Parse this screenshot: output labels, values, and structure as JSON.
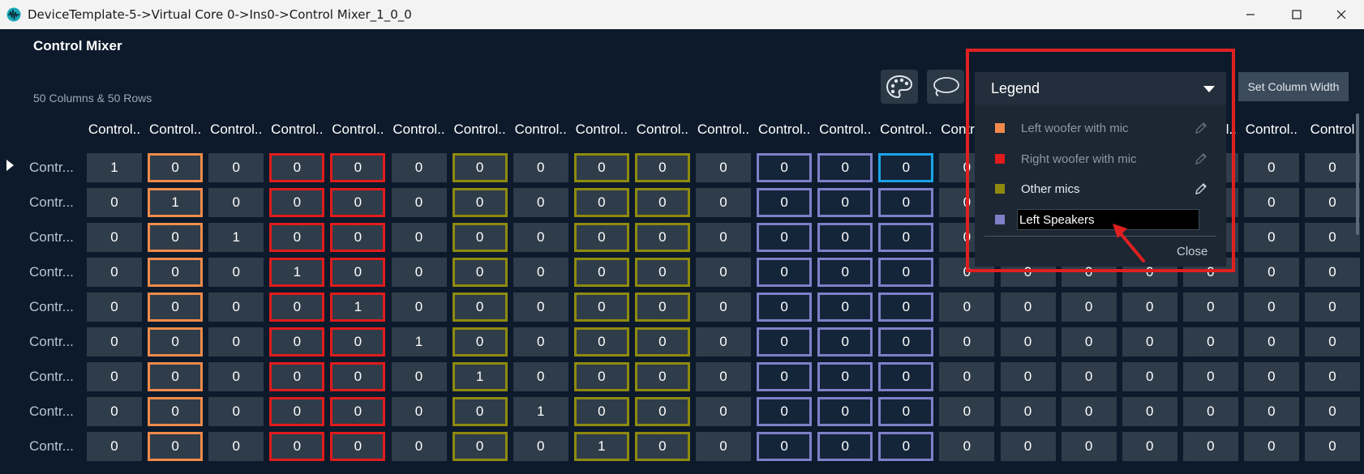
{
  "window": {
    "title": "DeviceTemplate-5->Virtual Core 0->Ins0->Control Mixer_1_0_0",
    "minimize_icon": "minimize-icon",
    "maximize_icon": "maximize-icon",
    "close_icon": "close-icon"
  },
  "app": {
    "title": "Control Mixer",
    "dimensions_text": "50 Columns & 50 Rows",
    "palette_icon": "palette-icon",
    "lasso_icon": "lasso-icon",
    "set_column_width_label": "Set Column Width"
  },
  "grid": {
    "column_headers": [
      "Control..",
      "Control..",
      "Control..",
      "Control..",
      "Control..",
      "Control..",
      "Control..",
      "Control..",
      "Control..",
      "Control..",
      "Control..",
      "Control..",
      "Control..",
      "Control..",
      "Control..",
      "Control..",
      "Control..",
      "Control..",
      "Control..",
      "Control..",
      "Control"
    ],
    "row_headers": [
      "Contr...",
      "Contr...",
      "Contr...",
      "Contr...",
      "Contr...",
      "Contr...",
      "Contr...",
      "Contr...",
      "Contr..."
    ],
    "column_groups": [
      "",
      "orange",
      "",
      "red",
      "red",
      "",
      "olive",
      "",
      "olive",
      "olive",
      "",
      "lavender",
      "lavender",
      "lavender",
      "",
      "",
      "",
      "",
      "",
      "",
      ""
    ],
    "rows": [
      [
        "1",
        "0",
        "0",
        "0",
        "0",
        "0",
        "0",
        "0",
        "0",
        "0",
        "0",
        "0",
        "0",
        "0",
        "0",
        "0",
        "0",
        "0",
        "0",
        "0",
        "0"
      ],
      [
        "0",
        "1",
        "0",
        "0",
        "0",
        "0",
        "0",
        "0",
        "0",
        "0",
        "0",
        "0",
        "0",
        "0",
        "0",
        "0",
        "0",
        "0",
        "0",
        "0",
        "0"
      ],
      [
        "0",
        "0",
        "1",
        "0",
        "0",
        "0",
        "0",
        "0",
        "0",
        "0",
        "0",
        "0",
        "0",
        "0",
        "0",
        "0",
        "0",
        "0",
        "0",
        "0",
        "0"
      ],
      [
        "0",
        "0",
        "0",
        "1",
        "0",
        "0",
        "0",
        "0",
        "0",
        "0",
        "0",
        "0",
        "0",
        "0",
        "0",
        "0",
        "0",
        "0",
        "0",
        "0",
        "0"
      ],
      [
        "0",
        "0",
        "0",
        "0",
        "1",
        "0",
        "0",
        "0",
        "0",
        "0",
        "0",
        "0",
        "0",
        "0",
        "0",
        "0",
        "0",
        "0",
        "0",
        "0",
        "0"
      ],
      [
        "0",
        "0",
        "0",
        "0",
        "0",
        "1",
        "0",
        "0",
        "0",
        "0",
        "0",
        "0",
        "0",
        "0",
        "0",
        "0",
        "0",
        "0",
        "0",
        "0",
        "0"
      ],
      [
        "0",
        "0",
        "0",
        "0",
        "0",
        "0",
        "1",
        "0",
        "0",
        "0",
        "0",
        "0",
        "0",
        "0",
        "0",
        "0",
        "0",
        "0",
        "0",
        "0",
        "0"
      ],
      [
        "0",
        "0",
        "0",
        "0",
        "0",
        "0",
        "0",
        "1",
        "0",
        "0",
        "0",
        "0",
        "0",
        "0",
        "0",
        "0",
        "0",
        "0",
        "0",
        "0",
        "0"
      ],
      [
        "0",
        "0",
        "0",
        "0",
        "0",
        "0",
        "0",
        "0",
        "1",
        "0",
        "0",
        "0",
        "0",
        "0",
        "0",
        "0",
        "0",
        "0",
        "0",
        "0",
        "0"
      ]
    ]
  },
  "legend": {
    "title": "Legend",
    "items": [
      {
        "label": "Left woofer with mic",
        "color": "#f08a4b"
      },
      {
        "label": "Right woofer with mic",
        "color": "#e01c1c"
      },
      {
        "label": "Other mics",
        "color": "#8f8a0f"
      }
    ],
    "editing": {
      "value": "Left Speakers",
      "color": "#7f7fc8"
    },
    "close_label": "Close"
  },
  "colors": {
    "orange": "#f08a4b",
    "red": "#e01c1c",
    "olive": "#8f8a0f",
    "lavender": "#7f7fc8",
    "selected": "#1aa3e8",
    "annotation": "#e02020"
  }
}
